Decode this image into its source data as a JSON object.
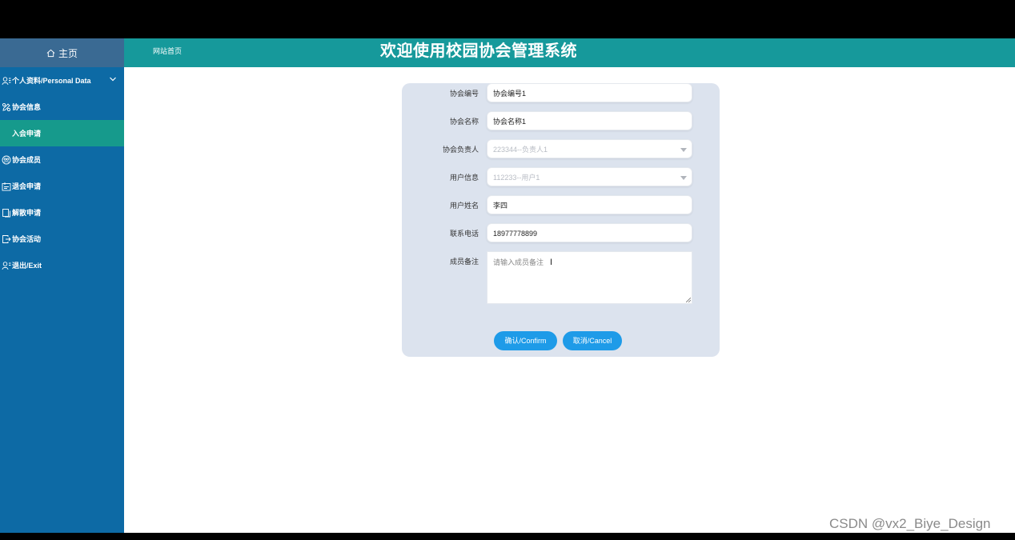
{
  "header": {
    "home_label": "主页",
    "site_link": "网站首页",
    "title": "欢迎使用校园协会管理系统"
  },
  "sidebar": {
    "items": [
      {
        "label": "个人资料/Personal Data",
        "icon": "user-icon"
      },
      {
        "label": "协会信息",
        "icon": "edit-icon"
      },
      {
        "label": "入会申请",
        "icon": "",
        "active": true
      },
      {
        "label": "协会成员",
        "icon": "group-icon"
      },
      {
        "label": "退会申请",
        "icon": "form-icon"
      },
      {
        "label": "解散申请",
        "icon": "copy-icon"
      },
      {
        "label": "协会活动",
        "icon": "export-icon"
      },
      {
        "label": "退出/Exit",
        "icon": "user-exit-icon"
      }
    ]
  },
  "form": {
    "fields": [
      {
        "label": "协会编号",
        "value": "协会编号1"
      },
      {
        "label": "协会名称",
        "value": "协会名称1"
      },
      {
        "label": "协会负责人",
        "value": "223344--负责人1"
      },
      {
        "label": "用户信息",
        "value": "112233--用户1"
      },
      {
        "label": "用户姓名",
        "value": "李四"
      },
      {
        "label": "联系电话",
        "value": "18977778899"
      }
    ],
    "remark": {
      "label": "成员备注",
      "placeholder": "请输入成员备注"
    },
    "confirm_label": "确认/Confirm",
    "cancel_label": "取消/Cancel"
  },
  "watermark": "CSDN @vx2_Biye_Design",
  "colors": {
    "header": "#16999b",
    "sidebar": "#0d6aa5",
    "active_item": "#169a8c",
    "card": "#dce3ee",
    "button": "#1e9be8"
  }
}
